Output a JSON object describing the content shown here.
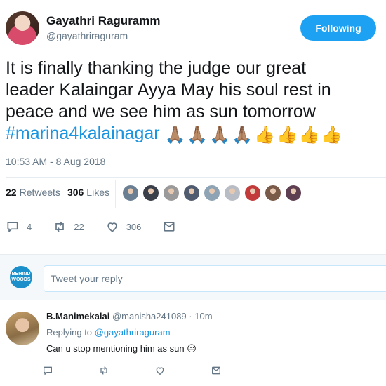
{
  "author": {
    "name": "Gayathri Raguramm",
    "handle": "@gayathriraguram"
  },
  "follow_button": "Following",
  "tweet": {
    "line1": "It is finally thanking the judge our great",
    "line2": "leader Kalaingar Ayya May his soul rest in",
    "line3": "peace and we see him as sun tomorrow",
    "hashtag": "#marina4kalainagar",
    "emojis": "🙏🏽🙏🏽🙏🏽🙏🏽👍👍👍👍",
    "timestamp": "10:53 AM - 8 Aug 2018"
  },
  "stats": {
    "retweets_count": "22",
    "retweets_label": "Retweets",
    "likes_count": "306",
    "likes_label": "Likes",
    "liker_colors": [
      "#6b7f93",
      "#3a3f4a",
      "#9a9a9a",
      "#4f5b6e",
      "#8ea3b4",
      "#b8bcc4",
      "#c23a3a",
      "#7a5a48",
      "#5e3f52"
    ]
  },
  "actions": {
    "replies": "4",
    "retweets": "22",
    "likes": "306"
  },
  "reply_box": {
    "avatar_line1": "BEHIND",
    "avatar_line2": "WOODS",
    "placeholder": "Tweet your reply"
  },
  "reply": {
    "name": "B.Manimekalai",
    "handle": "@manisha241089",
    "separator": "·",
    "time": "10m",
    "replying_to_label": "Replying to",
    "replying_to_handle": "@gayathriraguram",
    "text": "Can u stop mentioning him as sun",
    "emoji": "😒"
  },
  "colors": {
    "accent": "#1da1f2",
    "link": "#1b95e0",
    "muted": "#657786"
  }
}
